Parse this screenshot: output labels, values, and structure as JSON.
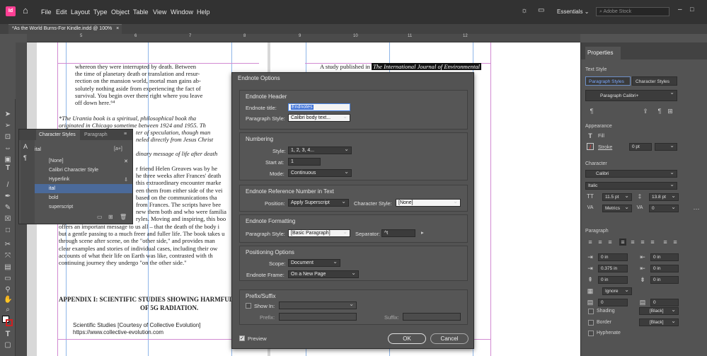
{
  "menubar": {
    "app_icon": "Id",
    "items": [
      "File",
      "Edit",
      "Layout",
      "Type",
      "Object",
      "Table",
      "View",
      "Window",
      "Help"
    ],
    "workspace": "Essentials",
    "search_placeholder": "Adobe Stock"
  },
  "document_tab": "*As the World Burns-For Kindle.indd @ 100%",
  "ruler_marks": [
    "5",
    "6",
    "7",
    "8",
    "9",
    "10",
    "11",
    "12"
  ],
  "page_text": {
    "para1_lines": [
      "whereon they were interrupted by death. Between",
      "the time of planetary death or translation and resur-",
      "rection on the mansion world, mortal man gains ab-",
      "solutely nothing aside from experiencing the fact of",
      "survival. You begin over there right where you leave",
      "off down here.⁶⁴"
    ],
    "para2_lines": [
      "*The Urantia book is a spiritual, philosophical book tha",
      "originated in Chicago sometime between 1924 and 1955. Th",
      "ter of speculation, though man",
      "neled directly from Jesus Christ"
    ],
    "para3_line": "dinary message of life after death",
    "para4_lines": [
      "r friend Helen Greaves was by he",
      "he three weeks after Frances' death",
      "this extraordinary encounter marke",
      "een them from either side of the vei",
      "based on the communications tha",
      "from Frances. The scripts have bee",
      "new them both and who were familia",
      "ryles. Moving and inspiring, this boo",
      "offers an important message to us all – that the death of the body i",
      "but a gentle passing to a much freer and fuller life. The book takes u",
      "through scene after scene, on the \"other side,\" and provides man",
      "clear examples and stories of individual cases, including their ow",
      "accounts of what their life on Earth was like, contrasted with th",
      "continuing journey they undergo \"on the other side.\""
    ],
    "appendix_heading_1": "APPENDIX I: SCIENTIFIC STUDIES SHOWING HARMFUL EFFECT",
    "appendix_heading_2": "OF 5G RADIATION.",
    "credit_1": "Scientific Studies [Courtesy of Collective Evolution]",
    "credit_2": "https://www.collective-evolution.com",
    "right_column_line": "A study published in",
    "right_column_highlight": "The International Journal of Environmental"
  },
  "character_styles_panel": {
    "tab_active": "Character Styles",
    "tab_other": "Paragraph",
    "search_value": "ital",
    "styles": [
      "[None]",
      "Calibri Character Style",
      "Hyperlink",
      "ital",
      "bold",
      "superscript"
    ],
    "selected": "ital"
  },
  "dialog": {
    "title": "Endnote Options",
    "header_section": {
      "title": "Endnote Header",
      "title_label": "Endnote title:",
      "title_value": "Endnotes",
      "para_style_label": "Paragraph Style:",
      "para_style_value": "Calibri body text..."
    },
    "numbering": {
      "title": "Numbering",
      "style_label": "Style:",
      "style_value": "1, 2, 3, 4...",
      "start_label": "Start at:",
      "start_value": "1",
      "mode_label": "Mode:",
      "mode_value": "Continuous"
    },
    "reference": {
      "title": "Endnote Reference Number in Text",
      "position_label": "Position:",
      "position_value": "Apply Superscript",
      "char_style_label": "Character Style:",
      "char_style_value": "[None]"
    },
    "formatting": {
      "title": "Endnote Formatting",
      "para_style_label": "Paragraph Style:",
      "para_style_value": "[Basic Paragraph]",
      "separator_label": "Separator:",
      "separator_value": "^t"
    },
    "positioning": {
      "title": "Positioning Options",
      "scope_label": "Scope:",
      "scope_value": "Document",
      "frame_label": "Endnote Frame:",
      "frame_value": "On a New Page"
    },
    "prefix": {
      "title": "Prefix/Suffix",
      "show_in_label": "Show In:",
      "prefix_label": "Prefix:",
      "suffix_label": "Suffix:"
    },
    "preview_label": "Preview",
    "preview_checked": true,
    "ok_label": "OK",
    "cancel_label": "Cancel"
  },
  "properties": {
    "title": "Properties",
    "text_style_label": "Text Style",
    "tab_para": "Paragraph Styles",
    "tab_char": "Character Styles",
    "para_style_value": "Paragraph Calibri+",
    "appearance_label": "Appearance",
    "fill_label": "Fill",
    "stroke_label": "Stroke",
    "stroke_value": "0 pt",
    "character_label": "Character",
    "font_value": "Calibri",
    "font_style_value": "Italic",
    "size_value": "11.5 pt",
    "leading_value": "13.8 pt",
    "kerning_value": "Metrics",
    "tracking_value": "0",
    "paragraph_label": "Paragraph",
    "left_indent": "0 in",
    "right_indent": "0 in",
    "first_indent": "0.375 in",
    "last_indent": "0 in",
    "space_before": "0 in",
    "space_after": "0 in",
    "grid_value": "Ignore",
    "drop_lines": "0",
    "drop_chars": "0",
    "shading_label": "Shading",
    "shading_color": "[Black]",
    "border_label": "Border",
    "border_color": "[Black]",
    "hyphenate_label": "Hyphenate"
  },
  "colors": {
    "accent": "#3a6fd8",
    "highlight_row": "#4b6a9a"
  }
}
